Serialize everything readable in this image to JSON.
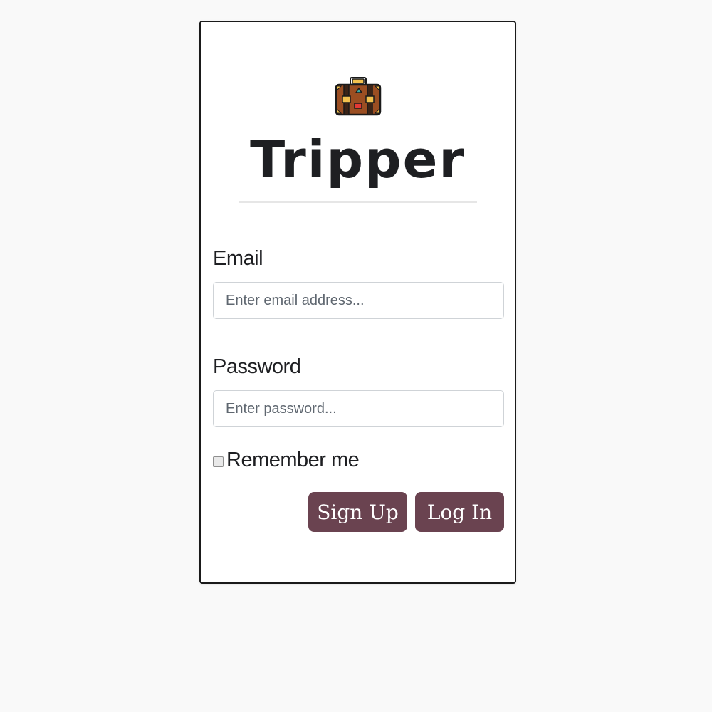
{
  "brand": {
    "title": "Tripper",
    "logo_icon": "suitcase-icon"
  },
  "form": {
    "email": {
      "label": "Email",
      "placeholder": "Enter email address...",
      "value": ""
    },
    "password": {
      "label": "Password",
      "placeholder": "Enter password...",
      "value": ""
    },
    "remember": {
      "label": "Remember me",
      "checked": false
    }
  },
  "actions": {
    "signup_label": "Sign Up",
    "login_label": "Log In"
  },
  "colors": {
    "button": "#6a4350",
    "page_background": "#f9f9f9",
    "card_border": "#1a1a1a"
  }
}
